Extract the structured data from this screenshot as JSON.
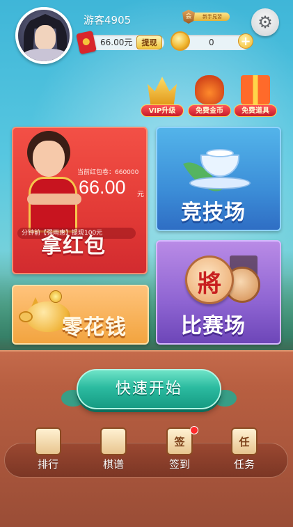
{
  "header": {
    "username": "游客4905",
    "rank_icon_char": "会",
    "rank_text": "新手見習",
    "cash": "66.00元",
    "withdraw_label": "提现",
    "coins": "0",
    "coin_plus": "+",
    "settings_icon": "gear-icon"
  },
  "promos": [
    {
      "label": "VIP升级",
      "icon": "crown-icon"
    },
    {
      "label": "免费金币",
      "icon": "money-bag-icon"
    },
    {
      "label": "免费道具",
      "icon": "gift-box-icon"
    }
  ],
  "cards": {
    "red_packet": {
      "jackpot_label": "当前红包卷：660000",
      "amount": "66.00",
      "unit": "元",
      "ticker": "分钟前【强雨惠】提现100元",
      "title": "拿红包"
    },
    "arena": {
      "title": "竞技场"
    },
    "tournament": {
      "title": "比赛场",
      "piece_char": "將"
    },
    "pocket_money": {
      "title": "零花钱"
    }
  },
  "quick_start": {
    "label": "快速开始"
  },
  "nav": [
    {
      "label": "排行",
      "icon_char": "",
      "icon": "ranking-banner-icon"
    },
    {
      "label": "棋谱",
      "icon_char": "",
      "icon": "chess-manual-icon"
    },
    {
      "label": "签到",
      "icon_char": "签",
      "icon": "calendar-icon",
      "has_notification": true
    },
    {
      "label": "任务",
      "icon_char": "任",
      "icon": "task-scroll-icon"
    }
  ],
  "colors": {
    "accent_red": "#e23a36",
    "accent_blue": "#3c8ed8",
    "accent_purple": "#8e64d2",
    "accent_orange": "#f2a43f",
    "quick_start_green": "#2cbba0"
  }
}
